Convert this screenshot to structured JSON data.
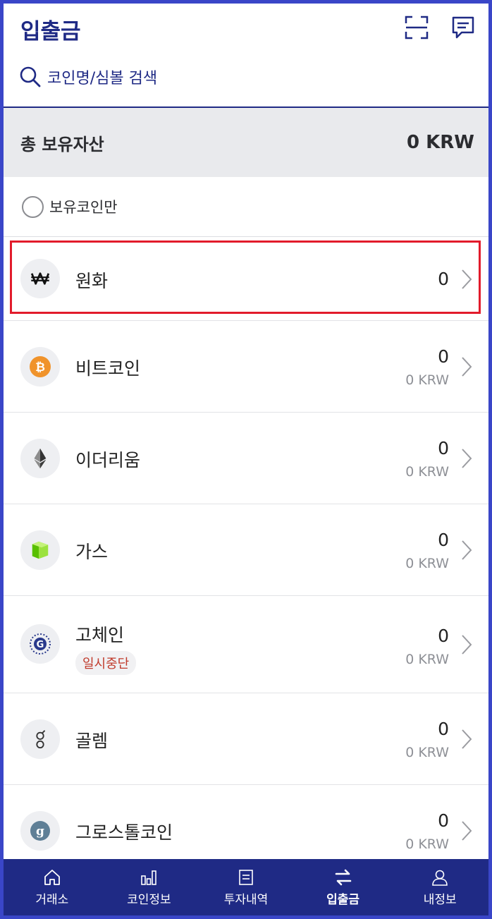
{
  "header": {
    "title": "입출금",
    "scan_icon": "scan-icon",
    "chat_icon": "chat-icon"
  },
  "search": {
    "placeholder": "코인명/심볼 검색"
  },
  "total": {
    "label": "총 보유자산",
    "value": "0 KRW"
  },
  "filter": {
    "label": "보유코인만",
    "checked": false
  },
  "coins": [
    {
      "name": "원화",
      "amount": "0",
      "krw": "",
      "icon": "won-icon",
      "selected": true
    },
    {
      "name": "비트코인",
      "amount": "0",
      "krw": "0 KRW",
      "icon": "bitcoin-icon"
    },
    {
      "name": "이더리움",
      "amount": "0",
      "krw": "0 KRW",
      "icon": "ethereum-icon"
    },
    {
      "name": "가스",
      "amount": "0",
      "krw": "0 KRW",
      "icon": "gas-icon"
    },
    {
      "name": "고체인",
      "amount": "0",
      "krw": "0 KRW",
      "icon": "gochain-icon",
      "badge": "일시중단"
    },
    {
      "name": "골렘",
      "amount": "0",
      "krw": "0 KRW",
      "icon": "golem-icon"
    },
    {
      "name": "그로스톨코인",
      "amount": "0",
      "krw": "0 KRW",
      "icon": "grs-icon"
    }
  ],
  "tabs": [
    {
      "label": "거래소",
      "icon": "home-icon"
    },
    {
      "label": "코인정보",
      "icon": "chart-icon"
    },
    {
      "label": "투자내역",
      "icon": "document-icon"
    },
    {
      "label": "입출금",
      "icon": "transfer-icon",
      "active": true
    },
    {
      "label": "내정보",
      "icon": "user-icon"
    }
  ],
  "colors": {
    "primary": "#1f2a85",
    "highlight": "#e21b2b",
    "badge_text": "#c03a2b",
    "frame": "#3a46c8"
  }
}
